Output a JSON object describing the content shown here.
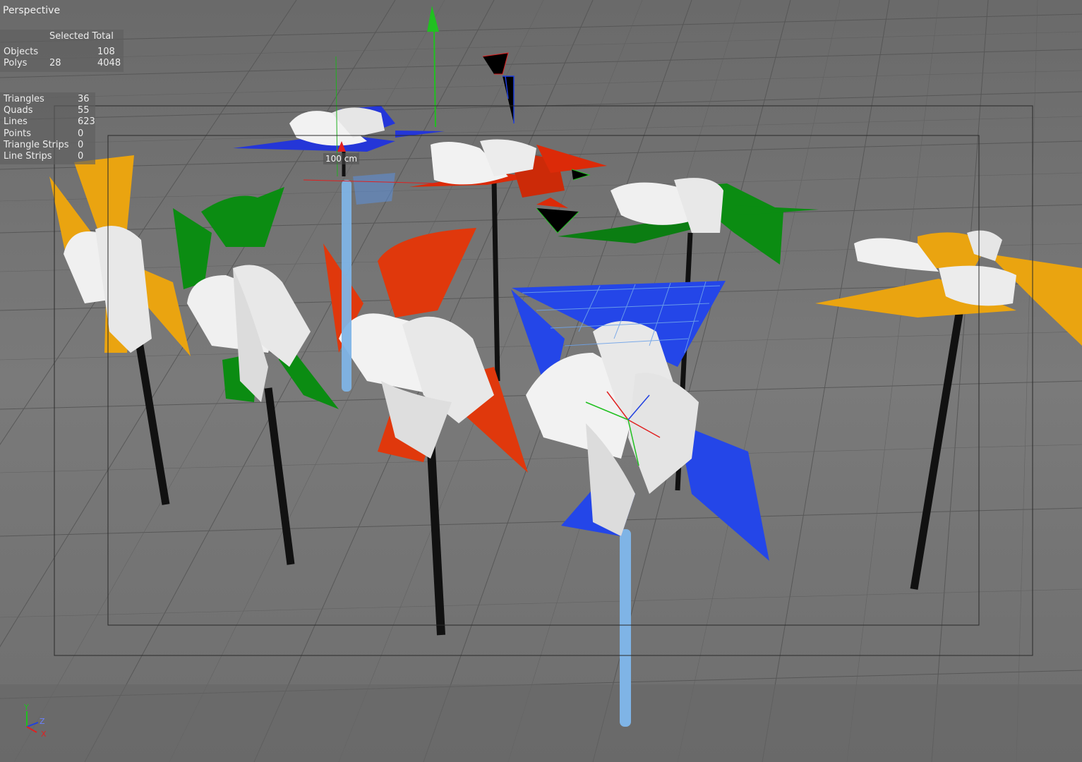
{
  "viewport": {
    "view_name": "Perspective",
    "scale_label": "100 cm"
  },
  "info_total": {
    "header": "Selected Total",
    "rows": [
      {
        "label": "Objects",
        "selected": "",
        "total": "108"
      },
      {
        "label": "Polys",
        "selected": "28",
        "total": "4048"
      }
    ]
  },
  "info_primitives": {
    "rows": [
      {
        "label": "Triangles",
        "value": "36"
      },
      {
        "label": "Quads",
        "value": "55"
      },
      {
        "label": "Lines",
        "value": "623"
      },
      {
        "label": "Points",
        "value": "0"
      },
      {
        "label": "Triangle Strips",
        "value": "0"
      },
      {
        "label": "Line Strips",
        "value": "0"
      }
    ]
  },
  "axis_gizmo": {
    "y_label": "Y",
    "z_label": "Z",
    "x_label": "X"
  },
  "colors": {
    "background": "#666666",
    "grid_line": "#4f4f4f",
    "orange": "#f0a50a",
    "green": "#0b8c12",
    "red": "#e03c0c",
    "blue": "#2446e8",
    "selected_stick": "#7fb4e6",
    "axis_x": "#e02020",
    "axis_y": "#20c020",
    "axis_z": "#2040e0"
  }
}
